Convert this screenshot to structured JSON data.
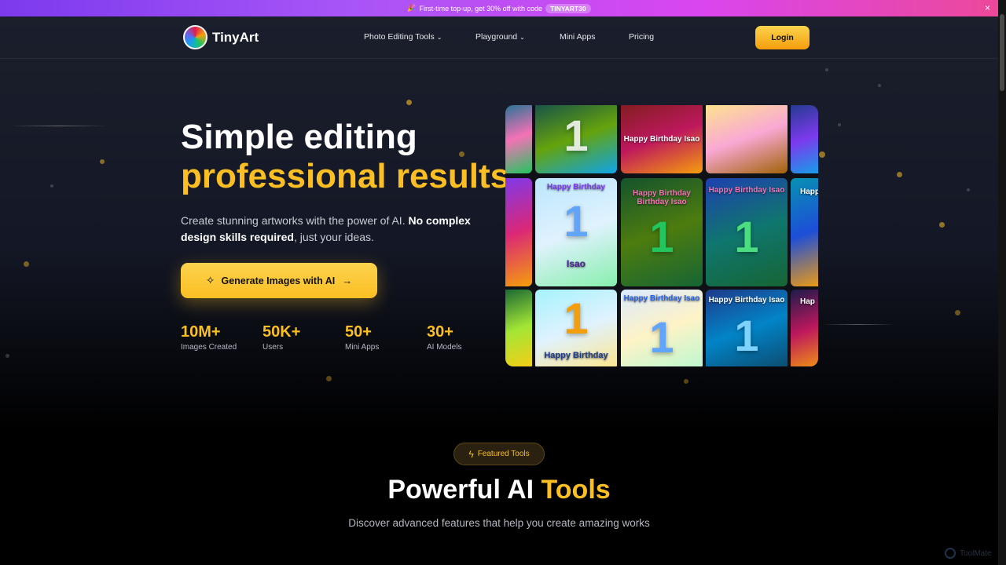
{
  "promo": {
    "emoji": "🎉",
    "text": "First-time top-up, get 30% off with code",
    "code": "TINYART30",
    "close": "×"
  },
  "nav": {
    "brand": "TinyArt",
    "items": [
      {
        "label": "Photo Editing Tools",
        "chevron": "⌄"
      },
      {
        "label": "Playground",
        "chevron": "⌄"
      },
      {
        "label": "Mini Apps"
      },
      {
        "label": "Pricing"
      }
    ],
    "login": "Login"
  },
  "hero": {
    "title_line1": "Simple editing",
    "title_line2": "professional results",
    "desc_part1": "Create stunning artworks with the power of AI. ",
    "desc_bold": "No complex design skills required",
    "desc_part2": ", just your ideas.",
    "cta_label": "Generate Images with AI",
    "cta_icon": "✧",
    "cta_arrow": "→",
    "stats": [
      {
        "value": "10M+",
        "label": "Images Created"
      },
      {
        "value": "50K+",
        "label": "Users"
      },
      {
        "value": "50+",
        "label": "Mini Apps"
      },
      {
        "value": "30+",
        "label": "AI Models"
      }
    ]
  },
  "gallery": {
    "captions": {
      "r1c2": "Happy Birthday Isao",
      "r2c1": "Happy Birthday",
      "r2c1_name": "Isao",
      "r2c2": "Happy Birthday Birthday Isao",
      "r2c3": "Happy Birthday Isao",
      "r2c4": "Happ",
      "r3c1": "Happy Birthday",
      "r3c2": "Happy Birthday Isao",
      "r3c3": "Happy Birthday Isao",
      "r3c4": "Hap"
    },
    "digit": "1"
  },
  "featured": {
    "badge": "Featured Tools",
    "badge_icon": "ϟ",
    "title_part1": "Powerful AI ",
    "title_part2": "Tools",
    "subtitle": "Discover advanced features that help you create amazing works"
  },
  "watermark": "ToolMate"
}
